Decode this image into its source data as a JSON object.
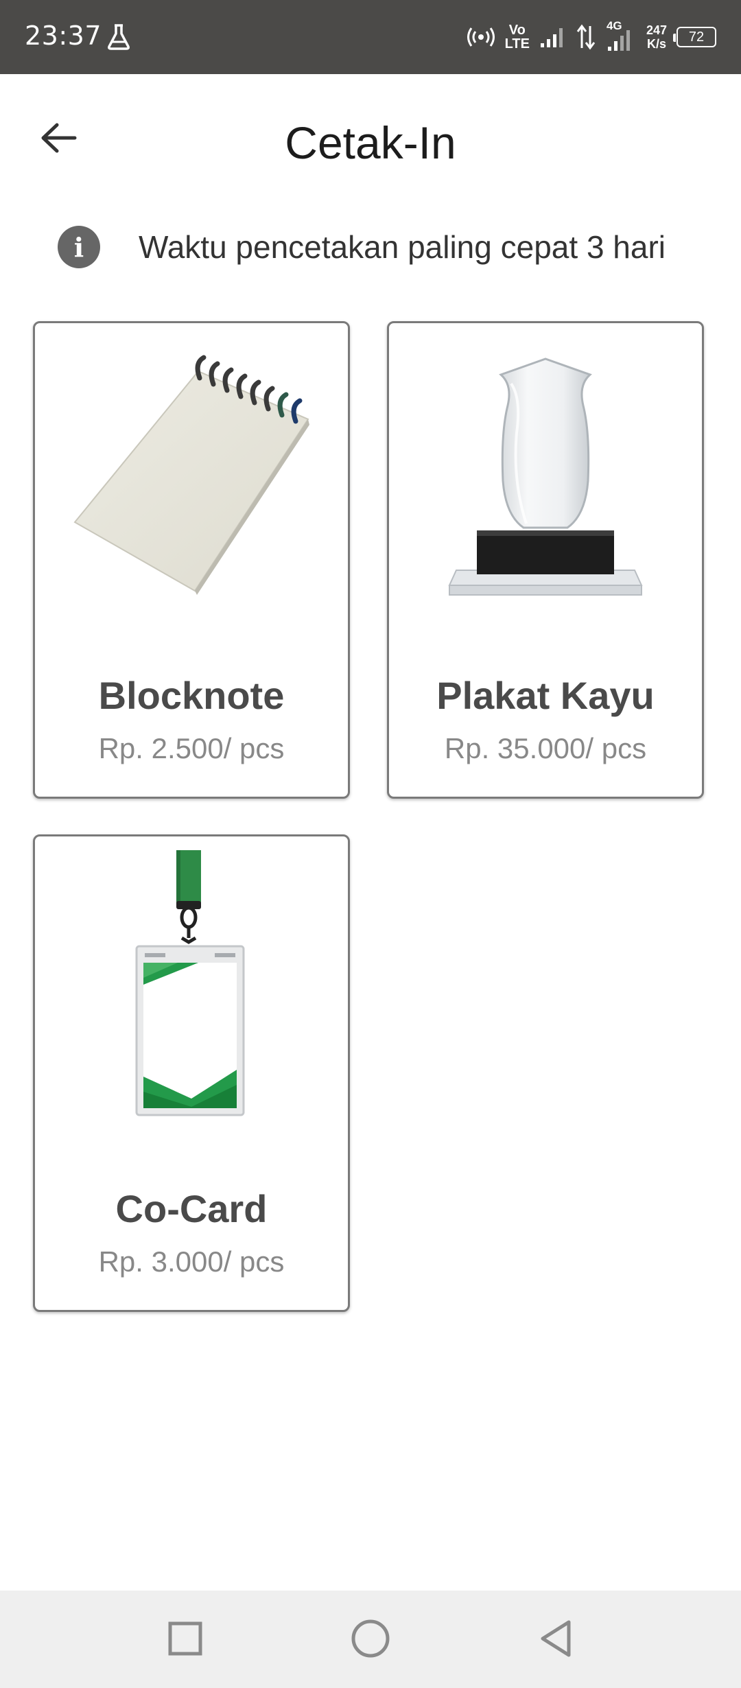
{
  "status_bar": {
    "time": "23:37",
    "volte_top": "Vo",
    "volte_bottom": "LTE",
    "network": "4G",
    "speed_value": "247",
    "speed_unit": "K/s",
    "battery": "72"
  },
  "header": {
    "title": "Cetak-In"
  },
  "info": {
    "text": "Waktu pencetakan paling cepat 3 hari"
  },
  "products": [
    {
      "name": "Blocknote",
      "price": "Rp. 2.500/ pcs",
      "image_icon": "notepad-image"
    },
    {
      "name": "Plakat Kayu",
      "price": "Rp. 35.000/ pcs",
      "image_icon": "trophy-plaque-image"
    },
    {
      "name": "Co-Card",
      "price": "Rp. 3.000/ pcs",
      "image_icon": "id-card-lanyard-image"
    }
  ],
  "colors": {
    "status_bar_bg": "#4b4a48",
    "card_border": "#7a7a7a",
    "lanyard_green": "#2e8b47",
    "nav_bar_bg": "#efefef"
  }
}
